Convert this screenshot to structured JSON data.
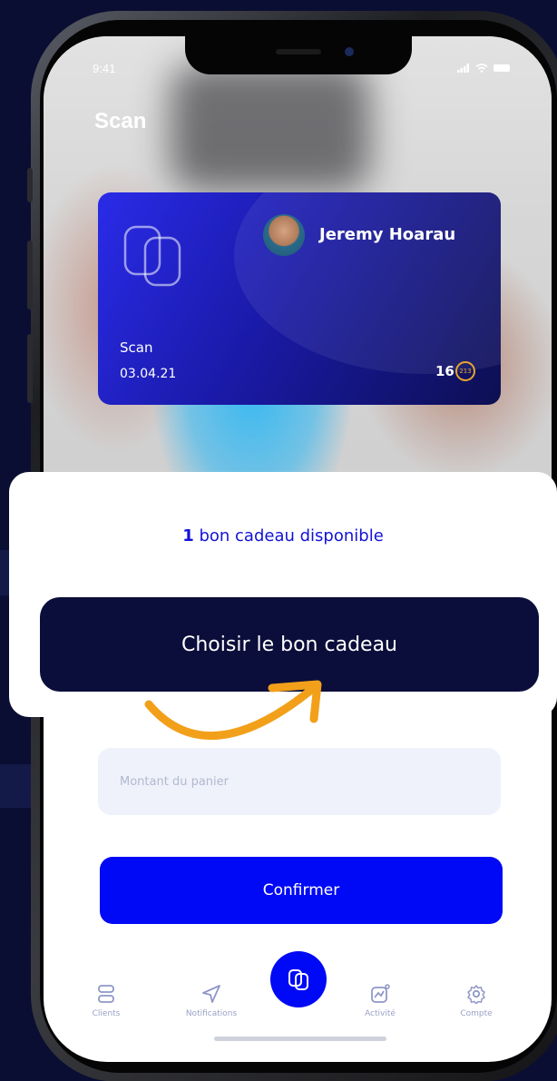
{
  "status_bar": {
    "time": "9:41"
  },
  "header": {
    "title": "Scan"
  },
  "card": {
    "holder_name": "Jeremy Hoarau",
    "label": "Scan",
    "date": "03.04.21",
    "points": "16",
    "coin_text": "213"
  },
  "popup": {
    "count": "1",
    "message": "bon cadeau disponible",
    "button_label": "Choisir le bon cadeau"
  },
  "form": {
    "amount_placeholder": "Montant du panier",
    "confirm_label": "Confirmer"
  },
  "nav": {
    "items": [
      {
        "label": "Clients",
        "icon": "clients-icon"
      },
      {
        "label": "Notifications",
        "icon": "send-icon"
      },
      {
        "label": "",
        "icon": "scan-icon"
      },
      {
        "label": "Activité",
        "icon": "activity-icon"
      },
      {
        "label": "Compte",
        "icon": "gear-icon"
      }
    ]
  },
  "colors": {
    "primary": "#0009f5",
    "dark_navy": "#0b0e3a",
    "accent_arrow": "#f2a01a",
    "background": "#0b0e33"
  }
}
